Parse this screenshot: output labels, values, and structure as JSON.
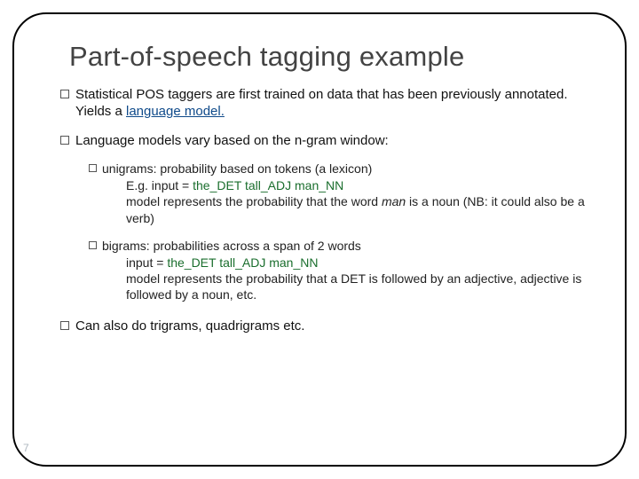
{
  "title": "Part-of-speech tagging example",
  "bullets": [
    {
      "text_pre": "Statistical POS taggers are first trained on data that has been previously annotated. Yields a ",
      "link": "language model.",
      "text_post": ""
    },
    {
      "text_pre": "Language models vary based on the n-gram window:",
      "link": "",
      "text_post": ""
    },
    {
      "text_pre": "Can also do trigrams, quadrigrams etc.",
      "link": "",
      "text_post": ""
    }
  ],
  "sub_unigrams": {
    "head": "unigrams: probability based on tokens (a lexicon)",
    "eg_prefix": "E.g. input = ",
    "input": "the_DET tall_ADJ man_NN",
    "line2_pre": "model represents the probability that the word ",
    "man": "man",
    "line2_post": " is a noun (NB: it could also be a verb)"
  },
  "sub_bigrams": {
    "head": "bigrams: probabilities across a span of 2 words",
    "input_prefix": "input = ",
    "input": "the_DET tall_ADJ man_NN",
    "line2": "model represents the probability that a DET is followed by an adjective, adjective is followed by a noun, etc."
  },
  "page_number": "7"
}
